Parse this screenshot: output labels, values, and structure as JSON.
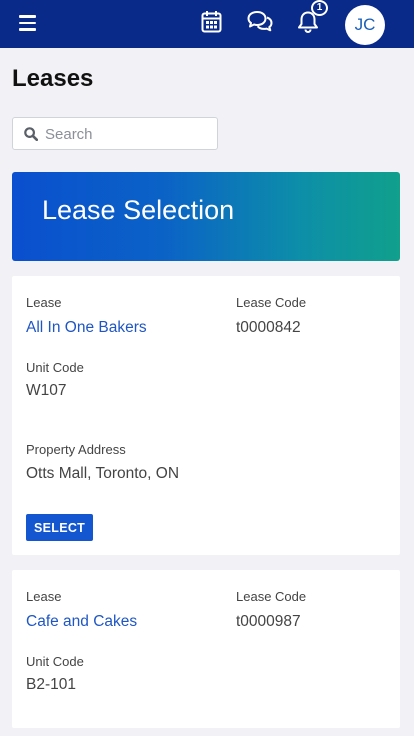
{
  "header": {
    "notification_count": "1",
    "avatar_initials": "JC"
  },
  "page": {
    "title": "Leases"
  },
  "search": {
    "placeholder": "Search"
  },
  "banner": {
    "title": "Lease Selection"
  },
  "leases": [
    {
      "lease_label": "Lease",
      "lease_name": "All In One Bakers",
      "code_label": "Lease Code",
      "code": "t0000842",
      "unit_label": "Unit Code",
      "unit": "W107",
      "address_label": "Property Address",
      "address": "Otts Mall, Toronto, ON",
      "select_label": "SELECT"
    },
    {
      "lease_label": "Lease",
      "lease_name": "Cafe and Cakes",
      "code_label": "Lease Code",
      "code": "t0000987",
      "unit_label": "Unit Code",
      "unit": "B2-101"
    }
  ],
  "colors": {
    "header_bg": "#0a2a8a",
    "link": "#1f56c4",
    "button": "#1456cf",
    "banner_start": "#0a4fcf",
    "banner_end": "#10a08c"
  }
}
